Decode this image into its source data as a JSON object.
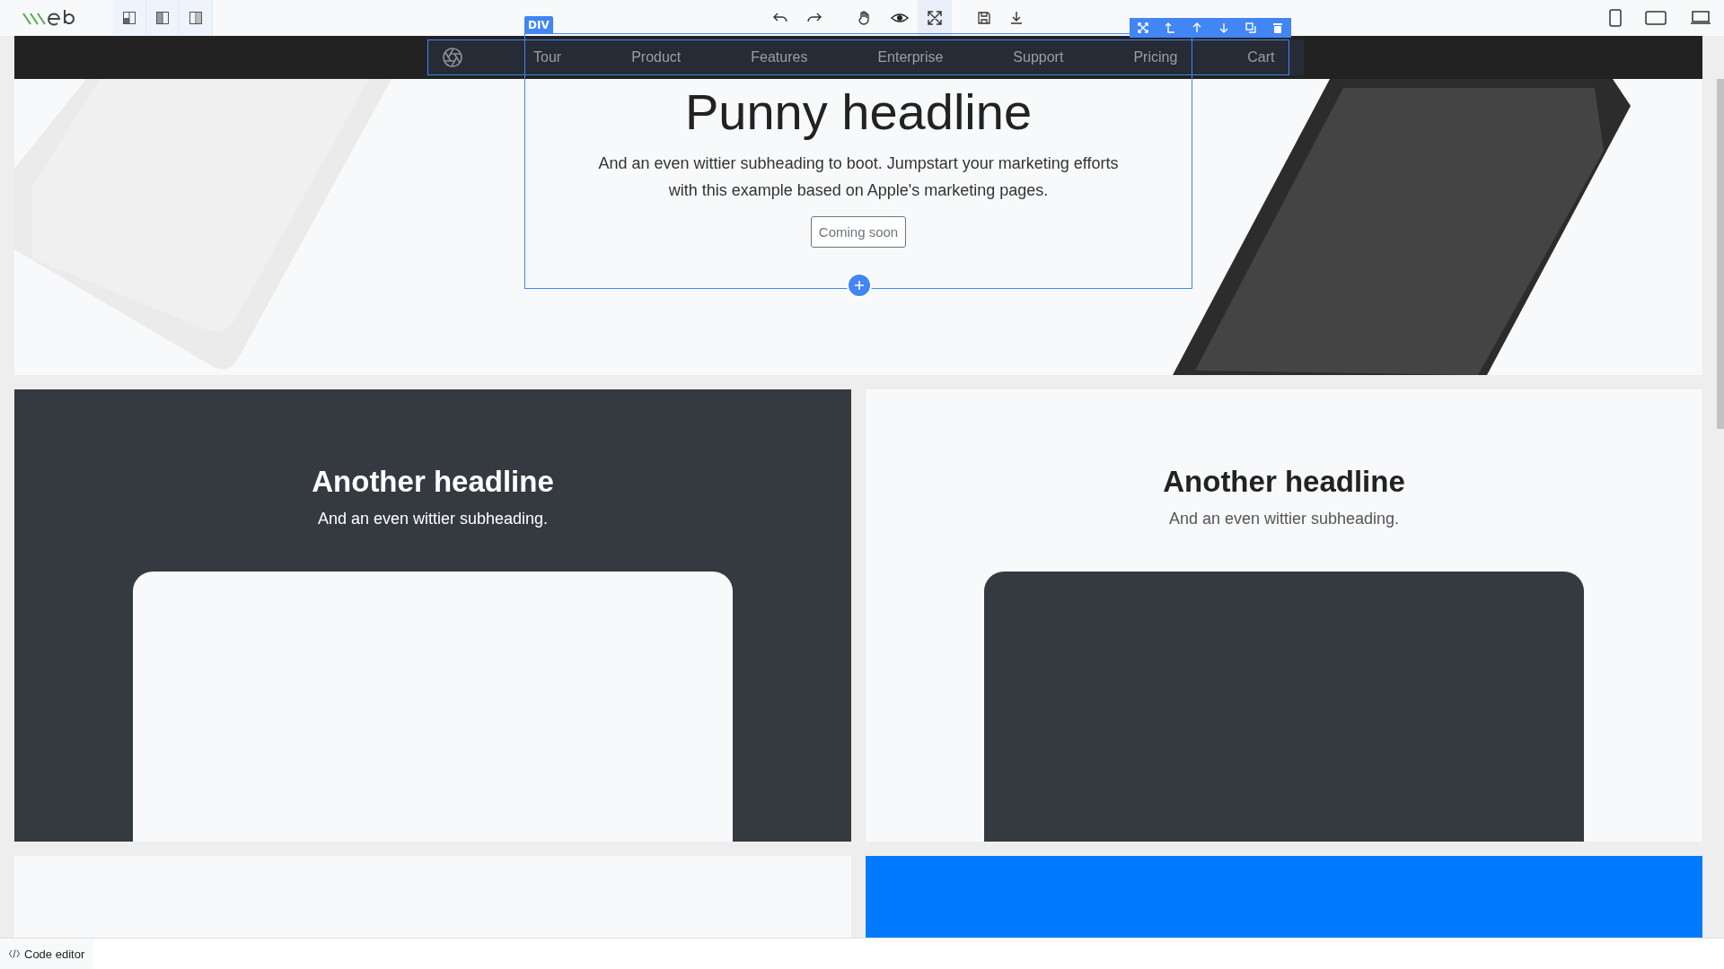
{
  "editor": {
    "selection_label": "DIV",
    "code_editor": "Code editor"
  },
  "nav": {
    "items": [
      {
        "label": "Tour"
      },
      {
        "label": "Product"
      },
      {
        "label": "Features"
      },
      {
        "label": "Enterprise"
      },
      {
        "label": "Support"
      },
      {
        "label": "Pricing"
      },
      {
        "label": "Cart"
      }
    ]
  },
  "hero": {
    "headline": "Punny headline",
    "subheading": "And an even wittier subheading to boot. Jumpstart your marketing efforts with this example based on Apple's marketing pages.",
    "button": "Coming soon"
  },
  "cards": [
    {
      "kind": "dark",
      "headline": "Another headline",
      "subheading": "And an even wittier subheading."
    },
    {
      "kind": "light",
      "headline": "Another headline",
      "subheading": "And an even wittier subheading."
    },
    {
      "kind": "light"
    },
    {
      "kind": "blue"
    }
  ]
}
